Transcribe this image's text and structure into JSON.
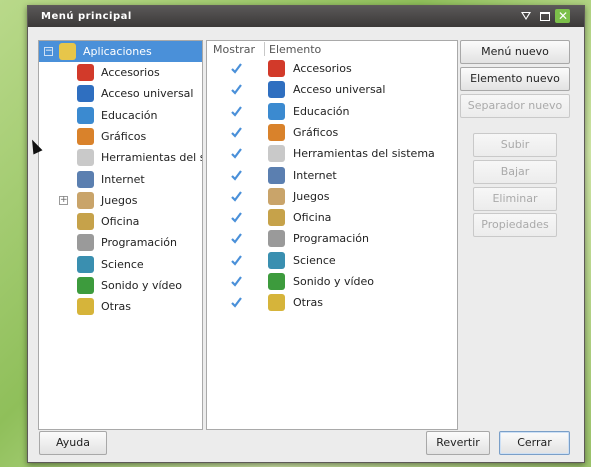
{
  "window": {
    "title": "Menú principal"
  },
  "tree": {
    "root": "Aplicaciones",
    "items": [
      {
        "label": "Accesorios",
        "icon": "accessories-icon",
        "color": "#d23a2a"
      },
      {
        "label": "Acceso universal",
        "icon": "universal-access-icon",
        "color": "#2f6fc0"
      },
      {
        "label": "Educación",
        "icon": "education-icon",
        "color": "#3b8ad0"
      },
      {
        "label": "Gráficos",
        "icon": "graphics-icon",
        "color": "#d9822b"
      },
      {
        "label": "Herramientas del s",
        "icon": "system-tools-icon",
        "color": "#c9c9c9"
      },
      {
        "label": "Internet",
        "icon": "internet-icon",
        "color": "#5b7fb0"
      },
      {
        "label": "Juegos",
        "icon": "games-icon",
        "color": "#c9a46a"
      },
      {
        "label": "Oficina",
        "icon": "office-icon",
        "color": "#c6a24a"
      },
      {
        "label": "Programación",
        "icon": "programming-icon",
        "color": "#9a9a9a"
      },
      {
        "label": "Science",
        "icon": "science-icon",
        "color": "#3a8fb0"
      },
      {
        "label": "Sonido y vídeo",
        "icon": "sound-video-icon",
        "color": "#3d9b3d"
      },
      {
        "label": "Otras",
        "icon": "other-icon",
        "color": "#d6b43a"
      }
    ]
  },
  "list": {
    "col_show": "Mostrar",
    "col_item": "Elemento",
    "items": [
      {
        "label": "Accesorios",
        "checked": true
      },
      {
        "label": "Acceso universal",
        "checked": true
      },
      {
        "label": "Educación",
        "checked": true
      },
      {
        "label": "Gráficos",
        "checked": true
      },
      {
        "label": "Herramientas del sistema",
        "checked": true
      },
      {
        "label": "Internet",
        "checked": true
      },
      {
        "label": "Juegos",
        "checked": true
      },
      {
        "label": "Oficina",
        "checked": true
      },
      {
        "label": "Programación",
        "checked": true
      },
      {
        "label": "Science",
        "checked": true
      },
      {
        "label": "Sonido y vídeo",
        "checked": true
      },
      {
        "label": "Otras",
        "checked": true
      }
    ]
  },
  "buttons": {
    "new_menu": "Menú nuevo",
    "new_item": "Elemento nuevo",
    "new_separator": "Separador nuevo",
    "up": "Subir",
    "down": "Bajar",
    "delete": "Eliminar",
    "properties": "Propiedades",
    "help": "Ayuda",
    "revert": "Revertir",
    "close": "Cerrar"
  },
  "colors": {
    "selection": "#4a90d9",
    "check": "#4a90d9",
    "close_button": "#7cc04a"
  }
}
